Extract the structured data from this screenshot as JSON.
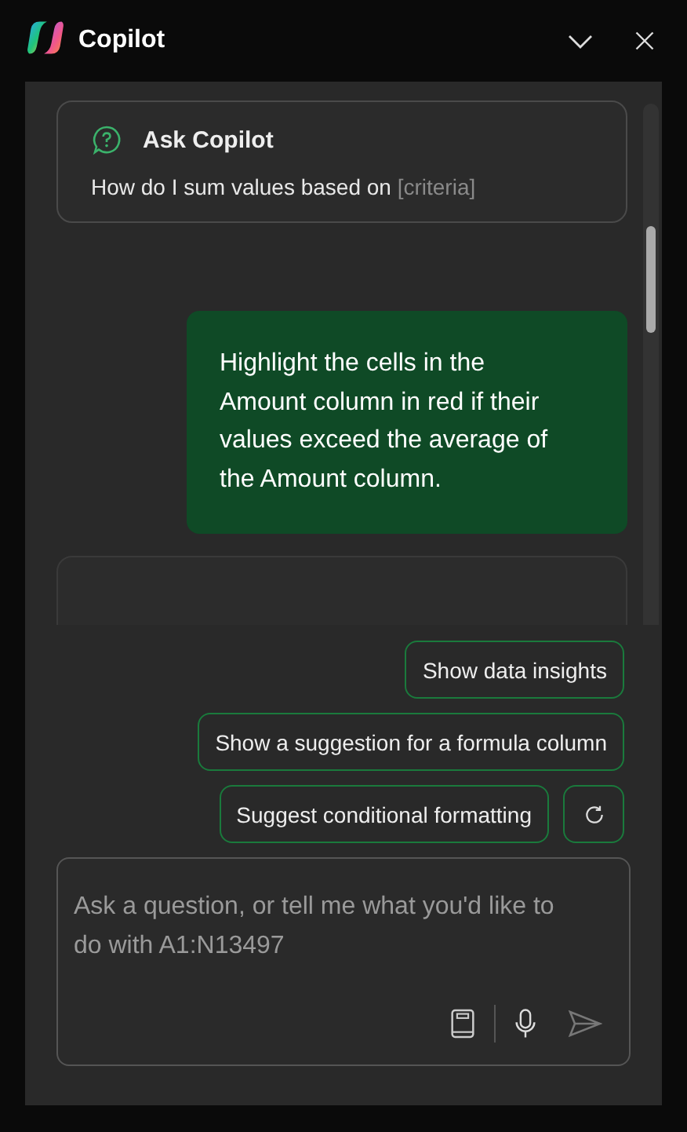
{
  "window": {
    "title": "Copilot"
  },
  "prompt_card": {
    "title": "Ask Copilot",
    "text": "How do I sum values based on",
    "placeholder_part": "[criteria]"
  },
  "messages": [
    {
      "kind": "user",
      "text": "Highlight the cells in the Amount column in red if their values exceed the average of the Amount column."
    },
    {
      "kind": "assistant"
    }
  ],
  "suggestions": [
    "Show data insights",
    "Show a suggestion for a formula column",
    "Suggest conditional formatting"
  ],
  "input": {
    "placeholder": "Ask a question, or tell me what you'd like to do with A1:N13497"
  }
}
